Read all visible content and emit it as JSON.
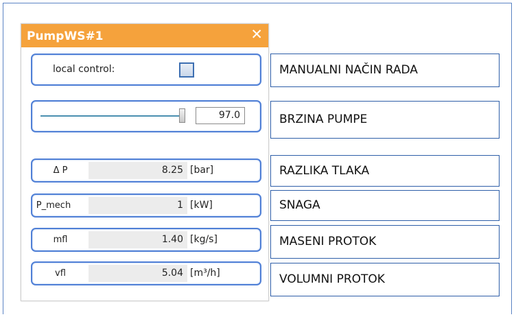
{
  "window": {
    "title": "PumpWS#1",
    "close_glyph": "✕",
    "accent": "#f5a23c",
    "frame_color": "#4f7fd6"
  },
  "controls": {
    "local_control_label": "local control:",
    "local_control_checked": false,
    "speed_value": "97.0"
  },
  "measurements": [
    {
      "label": "Δ P",
      "value": "8.25",
      "unit": "[bar]"
    },
    {
      "label": "P_mech",
      "value": "1",
      "unit": "[kW]"
    },
    {
      "label": "mfl",
      "value": "1.40",
      "unit": "[kg/s]"
    },
    {
      "label": "vfl",
      "value": "5.04",
      "unit": "[m³/h]"
    }
  ],
  "annotations": [
    "MANUALNI NAČIN RADA",
    "BRZINA PUMPE",
    "RAZLIKA TLAKA",
    "SNAGA",
    "MASENI PROTOK",
    "VOLUMNI PROTOK"
  ]
}
